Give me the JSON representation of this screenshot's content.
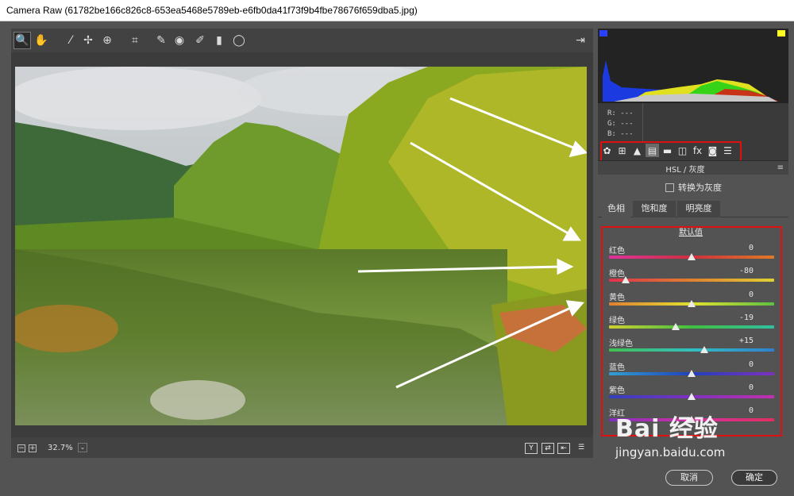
{
  "window": {
    "title": "Camera Raw (61782be166c826c8-653ea5468e5789eb-e6fb0da41f73f9b4fbe78676f659dba5.jpg)"
  },
  "toolbar": {
    "tools": [
      {
        "icon": "zoom-icon",
        "glyph": "🔍",
        "selected": true
      },
      {
        "icon": "hand-icon",
        "glyph": "✋"
      },
      {
        "icon": "eyedropper-icon",
        "glyph": "⁄"
      },
      {
        "icon": "color-sampler-icon",
        "glyph": "✢"
      },
      {
        "icon": "target-adjust-icon",
        "glyph": "⊕"
      },
      {
        "icon": "crop-icon",
        "glyph": "⌗"
      },
      {
        "icon": "spot-removal-icon",
        "glyph": "✎"
      },
      {
        "icon": "red-eye-icon",
        "glyph": "◉"
      },
      {
        "icon": "brush-icon",
        "glyph": "✐"
      },
      {
        "icon": "graduated-filter-icon",
        "glyph": "▮"
      },
      {
        "icon": "radial-filter-icon",
        "glyph": "◯"
      }
    ],
    "open_prefs_icon": "⇥"
  },
  "histogram": {
    "r_label": "R:",
    "g_label": "G:",
    "b_label": "B:",
    "r_val": "---",
    "g_val": "---",
    "b_val": "---"
  },
  "panel_tabs": [
    {
      "icon": "aperture-icon",
      "glyph": "✿"
    },
    {
      "icon": "tone-curve-icon",
      "glyph": "⊞"
    },
    {
      "icon": "detail-icon",
      "glyph": "▲"
    },
    {
      "icon": "hsl-icon",
      "glyph": "▤",
      "selected": true
    },
    {
      "icon": "split-toning-icon",
      "glyph": "▬"
    },
    {
      "icon": "lens-icon",
      "glyph": "◫"
    },
    {
      "icon": "fx-icon",
      "glyph": "fx"
    },
    {
      "icon": "camera-icon",
      "glyph": "◙"
    },
    {
      "icon": "presets-icon",
      "glyph": "☰"
    }
  ],
  "hsl": {
    "header": "HSL / 灰度",
    "menu_icon": "≡",
    "convert_gray": "转换为灰度",
    "subtabs": [
      "色相",
      "饱和度",
      "明亮度"
    ],
    "defaults": "默认值",
    "sliders": [
      {
        "label": "红色",
        "value": "0",
        "fraction": 0.5,
        "gradient": "linear-gradient(90deg,#e0309a,#d02f3c,#e07a26)"
      },
      {
        "label": "橙色",
        "value": "-80",
        "fraction": 0.1,
        "gradient": "linear-gradient(90deg,#e0304a,#e08030,#e0d030)"
      },
      {
        "label": "黄色",
        "value": "0",
        "fraction": 0.5,
        "gradient": "linear-gradient(90deg,#e08030,#e0e030,#60c040)"
      },
      {
        "label": "绿色",
        "value": "-19",
        "fraction": 0.405,
        "gradient": "linear-gradient(90deg,#d0d030,#40c040,#30c0a0)"
      },
      {
        "label": "浅绿色",
        "value": "+15",
        "fraction": 0.575,
        "gradient": "linear-gradient(90deg,#40c050,#30c0c0,#3080d0)"
      },
      {
        "label": "蓝色",
        "value": "0",
        "fraction": 0.5,
        "gradient": "linear-gradient(90deg,#30a0d0,#2040c0,#8030c0)"
      },
      {
        "label": "紫色",
        "value": "0",
        "fraction": 0.5,
        "gradient": "linear-gradient(90deg,#3040c0,#8030c0,#c030b0)"
      },
      {
        "label": "洋红",
        "value": "0",
        "fraction": 0.5,
        "gradient": "linear-gradient(90deg,#8030c0,#d030a0,#e03060)"
      }
    ]
  },
  "bottom": {
    "zoom": "32.7%",
    "minus": "−",
    "plus": "+",
    "dropdown": "⌄",
    "view_y": "Y",
    "view_swap": "⇄",
    "view_copy": "⇤",
    "view_prefs": "☰"
  },
  "footer": {
    "cancel": "取消",
    "ok": "确定"
  },
  "watermark": {
    "logo": "Bai  经验",
    "url": "jingyan.baidu.com"
  }
}
